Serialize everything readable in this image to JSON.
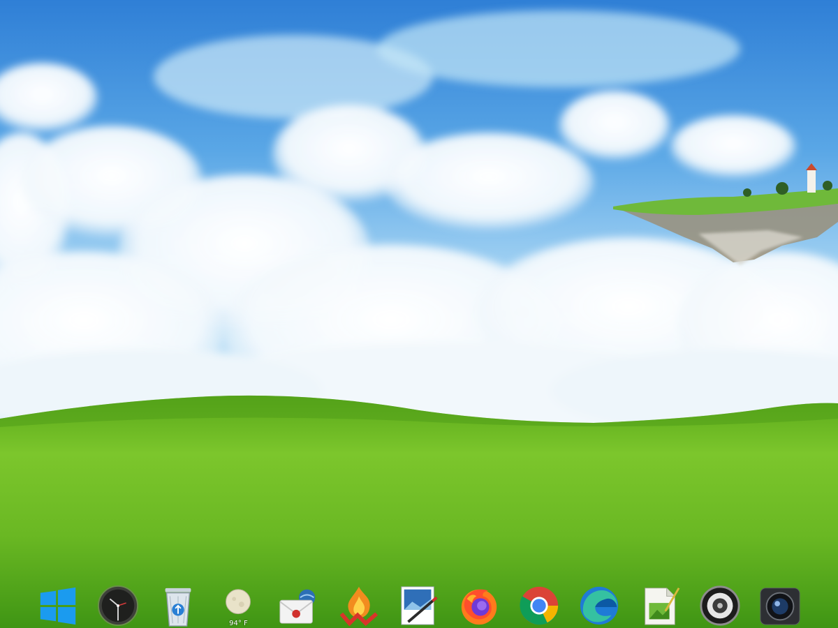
{
  "desktop": {
    "wallpaper": "sky-hills-floating-island",
    "colors": {
      "sky_top": "#2f7fd6",
      "sky_mid": "#8fc7f0",
      "grass_light": "#7cc62c",
      "grass_dark": "#2f8a12"
    }
  },
  "dock": {
    "items": [
      {
        "id": "start",
        "icon": "windows-logo-icon"
      },
      {
        "id": "clock",
        "icon": "clock-icon"
      },
      {
        "id": "recycle-bin",
        "icon": "recycle-bin-icon"
      },
      {
        "id": "weather",
        "icon": "weather-moon-icon",
        "label": "94° F"
      },
      {
        "id": "mail",
        "icon": "mail-icon"
      },
      {
        "id": "burner",
        "icon": "flame-icon"
      },
      {
        "id": "paint",
        "icon": "paint-icon"
      },
      {
        "id": "firefox",
        "icon": "firefox-icon"
      },
      {
        "id": "chrome",
        "icon": "chrome-icon"
      },
      {
        "id": "edge",
        "icon": "edge-icon"
      },
      {
        "id": "notepad",
        "icon": "notepad-icon"
      },
      {
        "id": "media-player",
        "icon": "speaker-icon"
      },
      {
        "id": "camera",
        "icon": "camera-icon"
      }
    ]
  }
}
